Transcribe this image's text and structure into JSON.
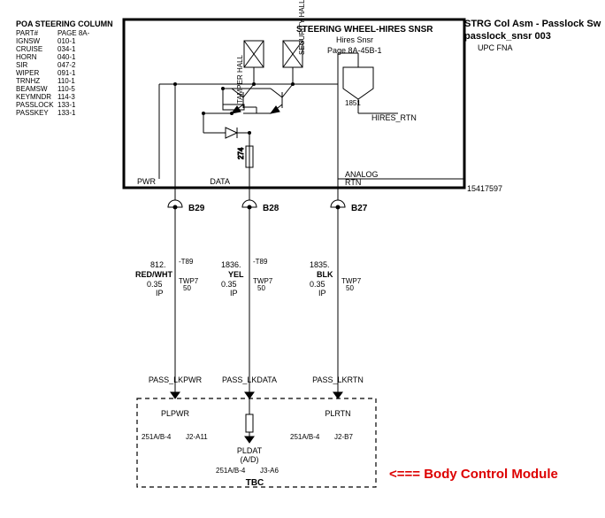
{
  "header": {
    "title": "POA STEERING COLUMN",
    "part_label": "PART#",
    "page_label": "PAGE 8A-",
    "rows": [
      {
        "name": "IGNSW",
        "page": "010-1"
      },
      {
        "name": "CRUISE",
        "page": "034-1"
      },
      {
        "name": "HORN",
        "page": "040-1"
      },
      {
        "name": "SIR",
        "page": "047-2"
      },
      {
        "name": "WIPER",
        "page": "091-1"
      },
      {
        "name": "TRNHZ",
        "page": "110-1"
      },
      {
        "name": "BEAMSW",
        "page": "110-5"
      },
      {
        "name": "KEYMNDR",
        "page": "114-3"
      },
      {
        "name": "PASSLOCK",
        "page": "133-1"
      },
      {
        "name": "PASSKEY",
        "page": "133-1"
      }
    ]
  },
  "title_block": {
    "l1": "STRG Col Asm - Passlock Sw",
    "l2": "passlock_snsr   003",
    "l3": "UPC   FNA"
  },
  "module_header": {
    "l1": "STEERING WHEEL-HIRES SNSR",
    "l2": "Hires Snsr",
    "l3": "Page 8A-45B-1"
  },
  "inner": {
    "tamper": "TAMPER HALL",
    "security": "SECURITY HALL",
    "r274": "274",
    "hires_net": "1851",
    "hires_rtn": "HIRES_RTN"
  },
  "rail": {
    "pwr": "PWR",
    "data": "DATA",
    "analog": "ANALOG RTN",
    "partnum": "15417597"
  },
  "conn": {
    "b29": "B29",
    "b28": "B28",
    "b27": "B27"
  },
  "wires": {
    "w1": {
      "num": "812.",
      "suf": "-T89",
      "color": "RED/WHT",
      "ga": "0.35",
      "loc": "IP",
      "twp": "TWP7",
      "twpn": "50"
    },
    "w2": {
      "num": "1836.",
      "suf": "-T89",
      "color": "YEL",
      "ga": "0.35",
      "loc": "IP",
      "twp": "TWP7",
      "twpn": "50"
    },
    "w3": {
      "num": "1835.",
      "suf": "",
      "color": "BLK",
      "ga": "0.35",
      "loc": "IP",
      "twp": "TWP7",
      "twpn": "50"
    }
  },
  "bottoms": {
    "pl1": "PASS_LKPWR",
    "pl2": "PASS_LKDATA",
    "pl3": "PASS_LKRTN"
  },
  "tbc": {
    "plpwr": "PLPWR",
    "plrtn": "PLRTN",
    "pldat": "PLDAT (A/D)",
    "ref1": "251A/B-4",
    "pin1": "J2-A11",
    "ref2": "251A/B-4",
    "pin2": "J3-A6",
    "ref3": "251A/B-4",
    "pin3": "J2-B7",
    "name": "TBC"
  },
  "annotation": {
    "text": "<=== Body Control Module"
  }
}
